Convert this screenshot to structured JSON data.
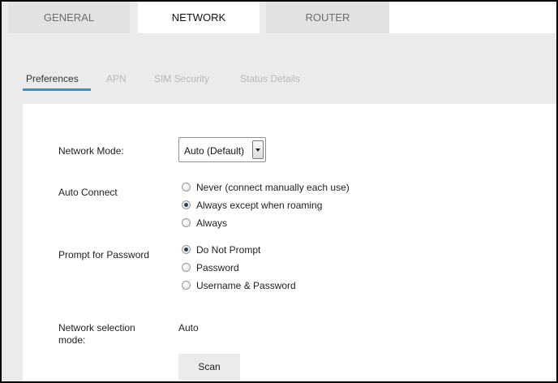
{
  "top_tabs": {
    "general": "GENERAL",
    "network": "NETWORK",
    "router": "ROUTER"
  },
  "sub_tabs": {
    "preferences": "Preferences",
    "apn": "APN",
    "sim_security": "SIM Security",
    "status_details": "Status Details"
  },
  "form": {
    "network_mode": {
      "label": "Network Mode:",
      "value": "Auto (Default)"
    },
    "auto_connect": {
      "label": "Auto Connect",
      "options": [
        {
          "label": "Never (connect manually each use)",
          "checked": false
        },
        {
          "label": "Always except when roaming",
          "checked": true
        },
        {
          "label": "Always",
          "checked": false
        }
      ]
    },
    "prompt_for_password": {
      "label": "Prompt for Password",
      "options": [
        {
          "label": "Do Not Prompt",
          "checked": true
        },
        {
          "label": "Password",
          "checked": false
        },
        {
          "label": "Username & Password",
          "checked": false
        }
      ]
    },
    "network_selection_mode": {
      "label_line1": "Network selection",
      "label_line2": "mode:",
      "value": "Auto"
    },
    "scan_label": "Scan"
  },
  "colors": {
    "active_underline": "#2b98d6",
    "page_background": "#ebebeb",
    "panel_background": "#ffffff"
  }
}
